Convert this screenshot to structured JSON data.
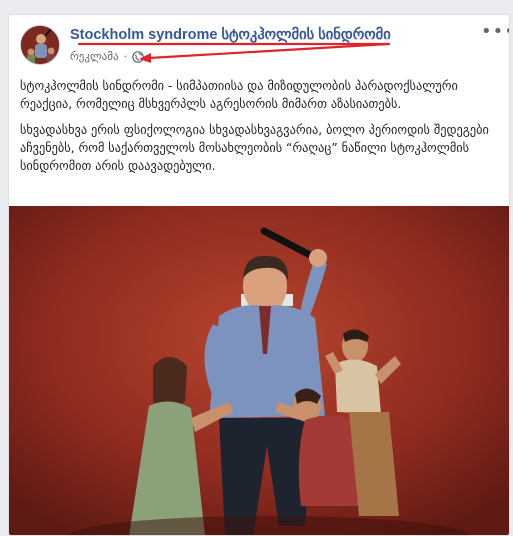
{
  "post": {
    "page_name_latin": "Stockholm syndrome",
    "page_name_georgian": "სტოკჰოლმის სინდრომი",
    "sponsored_label": "რეკლამა",
    "separator": "·",
    "more_label": "•••",
    "paragraphs": [
      "სტოკჰოლმის სინდრომი - სიმპათიისა და მიზიდულობის პარადოქსალური რეაქცია, რომელიც მსხვერპლს აგრესორის მიმართ აზასიათებს.",
      "სხვადასხვა ერის ფსიქოლოგია სხვადასხვაგვარია, ბოლო პერიოდის შედეგები აჩვენებს, რომ საქართველოს მოსახლეობის “რაღაც” ნაწილი სტოკჰოლმის სინდრომით არის დაავადებული."
    ]
  },
  "colors": {
    "link": "#365899",
    "annotation": "#e0252a",
    "image_bg": "#8f2b1f"
  },
  "icons": [
    "globe-icon",
    "more-icon"
  ]
}
